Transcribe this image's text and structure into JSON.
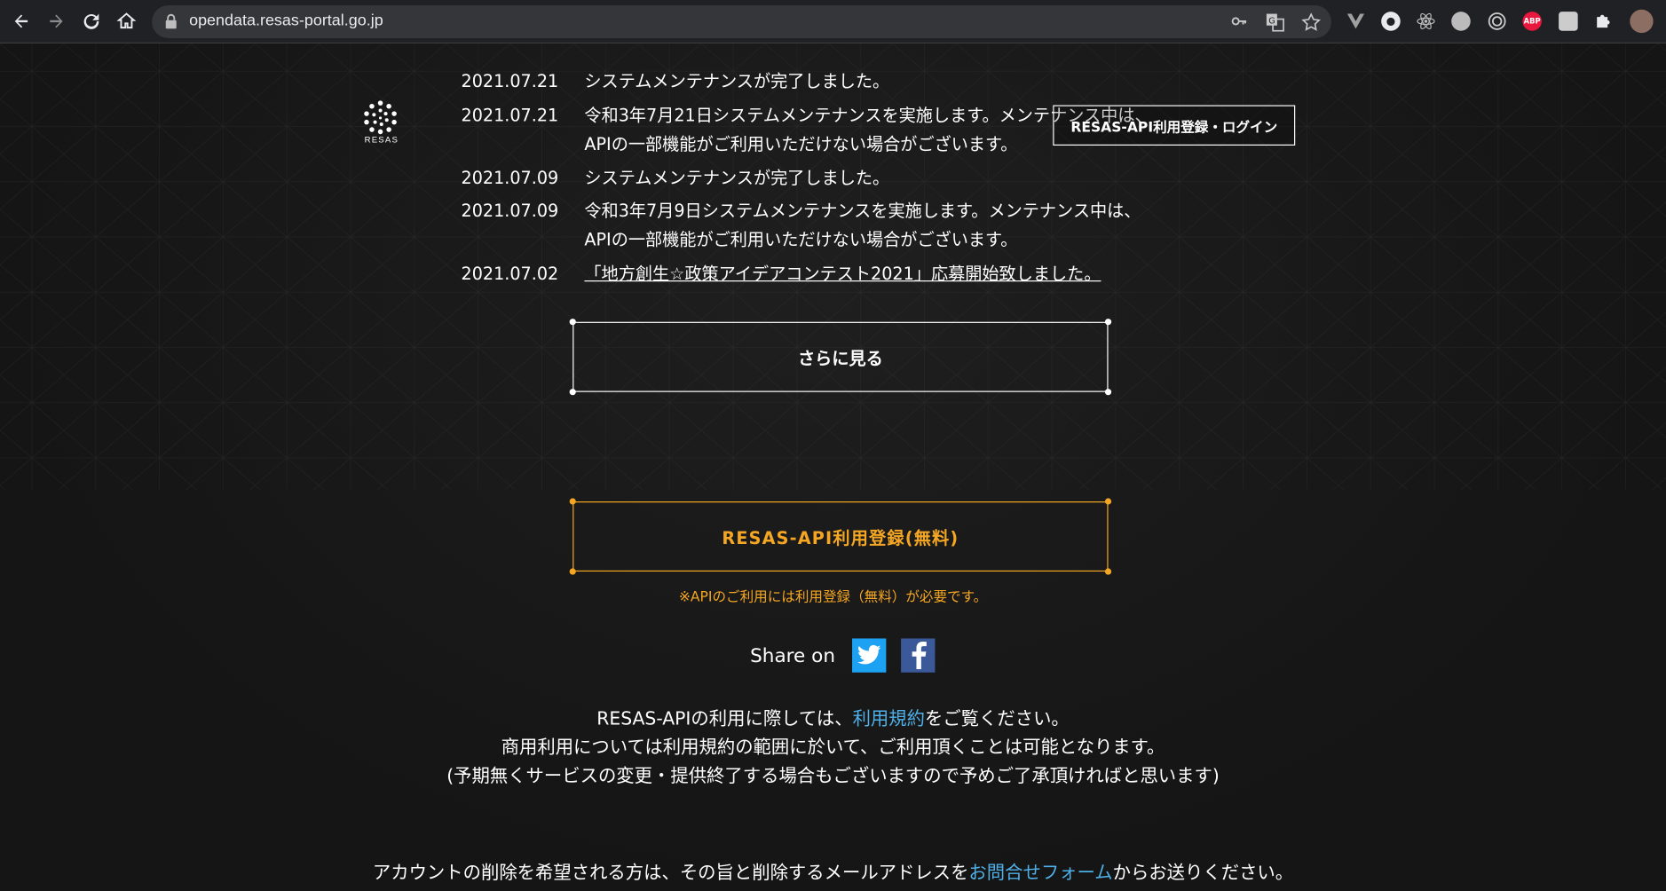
{
  "browser": {
    "url": "opendata.resas-portal.go.jp"
  },
  "header": {
    "logo_text": "RESAS",
    "login_button": "RESAS-API利用登録・ログイン"
  },
  "news": [
    {
      "date": "2021.07.21",
      "lines": [
        "システムメンテナンスが完了しました。"
      ],
      "link": false
    },
    {
      "date": "2021.07.21",
      "lines": [
        "令和3年7月21日システムメンテナンスを実施します。メンテナンス中は、",
        "APIの一部機能がご利用いただけない場合がございます。"
      ],
      "link": false
    },
    {
      "date": "2021.07.09",
      "lines": [
        "システムメンテナンスが完了しました。"
      ],
      "link": false
    },
    {
      "date": "2021.07.09",
      "lines": [
        "令和3年7月9日システムメンテナンスを実施します。メンテナンス中は、",
        "APIの一部機能がご利用いただけない場合がございます。"
      ],
      "link": false
    },
    {
      "date": "2021.07.02",
      "lines": [
        "「地方創生☆政策アイデアコンテスト2021」応募開始致しました。"
      ],
      "link": true
    }
  ],
  "more_button": "さらに見る",
  "register": {
    "button": "RESAS-API利用登録(無料)",
    "note": "※APIのご利用には利用登録（無料）が必要です。"
  },
  "share": {
    "label": "Share on"
  },
  "terms": {
    "line1_pre": "RESAS-APIの利用に際しては、",
    "line1_link": "利用規約",
    "line1_post": "をご覧ください。",
    "line2": "商用利用については利用規約の範囲に於いて、ご利用頂くことは可能となります。",
    "line3": "(予期無くサービスの変更・提供終了する場合もございますので予めご了承頂ければと思います)"
  },
  "account": {
    "pre": "アカウントの削除を希望される方は、その旨と削除するメールアドレスを",
    "link": "お問合せフォーム",
    "post": "からお送りください。"
  },
  "colors": {
    "accent": "#f5a623",
    "link": "#4fb0e8",
    "background": "#151515"
  }
}
